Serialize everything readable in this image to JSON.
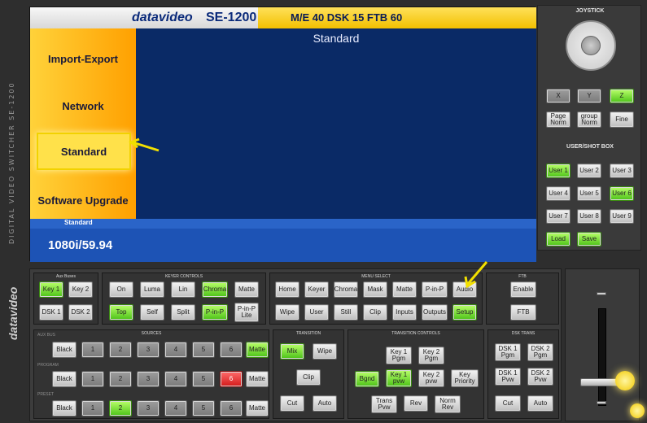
{
  "header": {
    "brand": "datavideo",
    "model": "SE-1200",
    "status": "M/E 40  DSK 15  FTB 60"
  },
  "side_label": "DIGITAL VIDEO SWITCHER SE-1200",
  "logo_text": "datavideo",
  "menu": {
    "items": [
      "Import-Export",
      "Network",
      "Standard",
      "Software Upgrade"
    ],
    "selected": "Standard"
  },
  "content": {
    "title": "Standard"
  },
  "status_strip": {
    "label": "Standard"
  },
  "info": {
    "format": "1080i/59.94"
  },
  "joystick": {
    "title": "JOYSTICK",
    "axes": [
      "X",
      "Y",
      "Z"
    ],
    "modes": [
      "Page Norm",
      "group Norm",
      "Fine"
    ]
  },
  "user_shot_box": {
    "title": "USER/SHOT BOX",
    "users": [
      "User 1",
      "User 2",
      "User 3",
      "User 4",
      "User 5",
      "User 6",
      "User 7",
      "User 8",
      "User 9"
    ],
    "actions": [
      "Load",
      "Save"
    ]
  },
  "aux_buses": {
    "title": "Aux Buses",
    "buttons": [
      "Key 1",
      "Key 2",
      "DSK 1",
      "DSK 2"
    ]
  },
  "keyer_controls": {
    "title": "KEYER CONTROLS",
    "row1": [
      "On",
      "Luma",
      "Lin",
      "Chroma",
      "Matte"
    ],
    "row2": [
      "Top",
      "Self",
      "Split",
      "P-in-P",
      "P-in-P Lite"
    ]
  },
  "menu_select": {
    "title": "MENU SELECT",
    "row1": [
      "Home",
      "Keyer",
      "Chroma",
      "Mask",
      "Matte",
      "P-in-P",
      "Audio"
    ],
    "row2": [
      "Wipe",
      "User",
      "Still",
      "Clip",
      "Inputs",
      "Outputs",
      "Setup"
    ]
  },
  "ftb": {
    "title": "FTB",
    "buttons": [
      "Enable",
      "FTB"
    ]
  },
  "sources": {
    "title": "SOURCES",
    "rows": [
      {
        "label": "AUX BUS",
        "buttons": [
          "Black",
          "1",
          "2",
          "3",
          "4",
          "5",
          "6",
          "Matte"
        ]
      },
      {
        "label": "PROGRAM",
        "buttons": [
          "Black",
          "1",
          "2",
          "3",
          "4",
          "5",
          "6",
          "Matte"
        ]
      },
      {
        "label": "PRESET",
        "buttons": [
          "Black",
          "1",
          "2",
          "3",
          "4",
          "5",
          "6",
          "Matte"
        ]
      }
    ]
  },
  "transition": {
    "title": "TRANSITION",
    "buttons": [
      "Mix",
      "Wipe",
      "Clip",
      "Cut",
      "Auto"
    ]
  },
  "transition_controls": {
    "title": "TRANSITION CONTROLS",
    "buttons": [
      "Key 1 Pgm",
      "Key 2 Pgm",
      "Bgnd",
      "Key 1 pvw",
      "Key 2 pvw",
      "Key Priority",
      "Trans Pvw",
      "Rev",
      "Norm Rev"
    ]
  },
  "dsk_trans": {
    "title": "DSK TRANS",
    "buttons": [
      "DSK 1 Pgm",
      "DSK 2 Pgm",
      "DSK 1 Pvw",
      "DSK 2 Pvw",
      "Cut",
      "Auto"
    ]
  },
  "colors": {
    "active_green": "#4cc218",
    "program_red": "#d21a1a",
    "menu_orange": "#ffa000",
    "screen_blue": "#0a2a66",
    "annotation_yellow": "#f2e000"
  }
}
